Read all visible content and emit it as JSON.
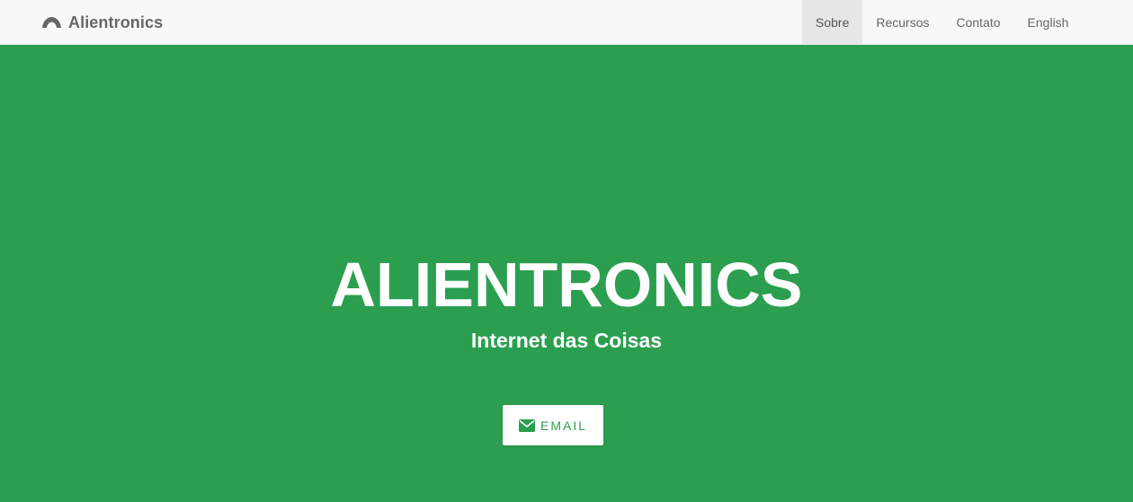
{
  "navbar": {
    "brand": "Alientronics",
    "brand_icon": "cloud-arc-icon",
    "items": [
      {
        "label": "Sobre",
        "active": true
      },
      {
        "label": "Recursos",
        "active": false
      },
      {
        "label": "Contato",
        "active": false
      },
      {
        "label": "English",
        "active": false
      }
    ]
  },
  "hero": {
    "title": "ALIENTRONICS",
    "subtitle": "Internet das Coisas",
    "button_label": "EMAIL",
    "button_icon": "envelope-icon"
  },
  "colors": {
    "hero_background": "#2b9f4f",
    "navbar_background": "#f8f8f8",
    "active_nav_background": "#e7e7e7",
    "text_muted": "#666666"
  }
}
